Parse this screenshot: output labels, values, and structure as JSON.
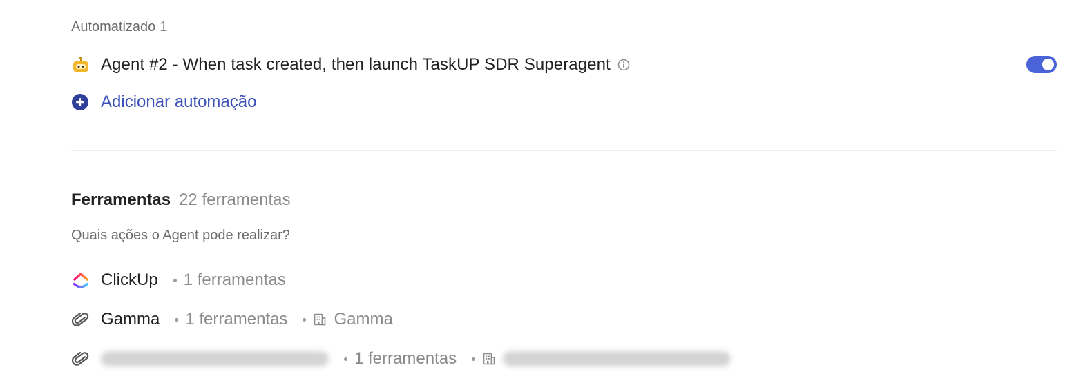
{
  "automation": {
    "section_label": "Automatizado",
    "section_count": "1",
    "agent": {
      "icon": "robot-icon",
      "name": "Agent #2 - When task created, then launch TaskUP SDR Superagent",
      "enabled": true
    },
    "add_label": "Adicionar automação"
  },
  "tools": {
    "title": "Ferramentas",
    "count_label": "22 ferramentas",
    "subtitle": "Quais ações o Agent pode realizar?",
    "items": [
      {
        "icon": "clickup-logo-icon",
        "name": "ClickUp",
        "count_label": "1 ferramentas"
      },
      {
        "icon": "paperclip-icon",
        "name": "Gamma",
        "count_label": "1 ferramentas",
        "workspace": "Gamma"
      },
      {
        "icon": "paperclip-icon",
        "name": "",
        "count_label": "1 ferramentas",
        "workspace": ""
      }
    ]
  },
  "colors": {
    "accent": "#4a63d9",
    "link": "#3c52b8",
    "muted": "#8a8a8a",
    "robot": "#f4b62b"
  }
}
